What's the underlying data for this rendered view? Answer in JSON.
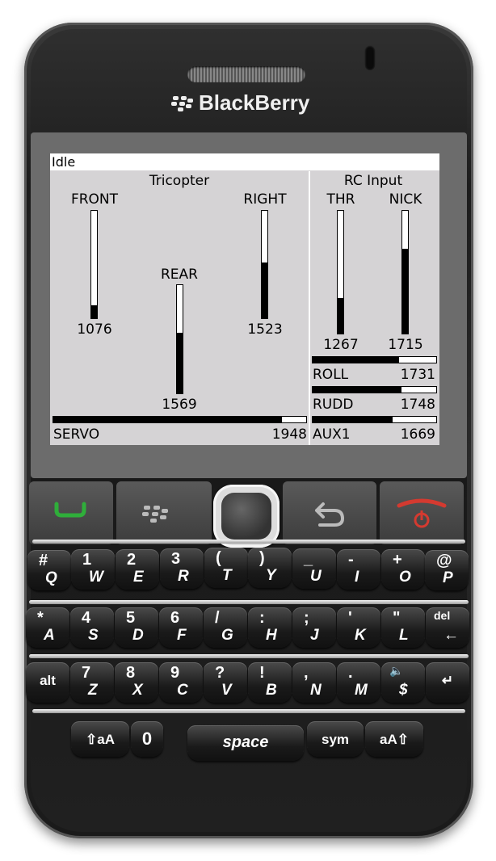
{
  "device": {
    "brand": "BlackBerry"
  },
  "status": {
    "text": "Idle"
  },
  "tricopter": {
    "title": "Tricopter",
    "front": {
      "label": "FRONT",
      "value": "1076",
      "level": 0.12
    },
    "rear": {
      "label": "REAR",
      "value": "1569",
      "level": 0.56
    },
    "right": {
      "label": "RIGHT",
      "value": "1523",
      "level": 0.52
    },
    "servo": {
      "label": "SERVO",
      "value": "1948",
      "level": 0.905
    }
  },
  "rc_input": {
    "title": "RC Input",
    "thr": {
      "label": "THR",
      "value": "1267",
      "level": 0.29
    },
    "nick": {
      "label": "NICK",
      "value": "1715",
      "level": 0.69
    },
    "roll": {
      "label": "ROLL",
      "value": "1731",
      "level": 0.7
    },
    "rudd": {
      "label": "RUDD",
      "value": "1748",
      "level": 0.72
    },
    "aux1": {
      "label": "AUX1",
      "value": "1669",
      "level": 0.65
    }
  },
  "keyboard": {
    "row1": [
      [
        "#",
        "Q"
      ],
      [
        "1",
        "W"
      ],
      [
        "2",
        "E"
      ],
      [
        "3",
        "R"
      ],
      [
        "(",
        "T"
      ],
      [
        ")",
        "Y"
      ],
      [
        "_",
        "U"
      ],
      [
        "-",
        "I"
      ],
      [
        "+",
        "O"
      ],
      [
        "@",
        "P"
      ]
    ],
    "row2": [
      [
        "*",
        "A"
      ],
      [
        "4",
        "S"
      ],
      [
        "5",
        "D"
      ],
      [
        "6",
        "F"
      ],
      [
        "/",
        "G"
      ],
      [
        ":",
        "H"
      ],
      [
        ";",
        "J"
      ],
      [
        "'",
        "K"
      ],
      [
        "\"",
        "L"
      ],
      [
        "del",
        "←"
      ]
    ],
    "row3": [
      [
        "",
        "alt"
      ],
      [
        "7",
        "Z"
      ],
      [
        "8",
        "X"
      ],
      [
        "9",
        "C"
      ],
      [
        "?",
        "V"
      ],
      [
        "!",
        "B"
      ],
      [
        ",",
        "N"
      ],
      [
        ".",
        "M"
      ],
      [
        "🔈",
        "$"
      ],
      [
        "",
        "↵"
      ]
    ],
    "row4": {
      "shift_left": "⇧aA",
      "zero": "0",
      "space": "space",
      "sym": "sym",
      "shift_right": "aA⇧"
    }
  },
  "colors": {
    "screen_bg": "#d5d3d5",
    "call_green": "#2fae3a",
    "end_red": "#d43a30"
  }
}
